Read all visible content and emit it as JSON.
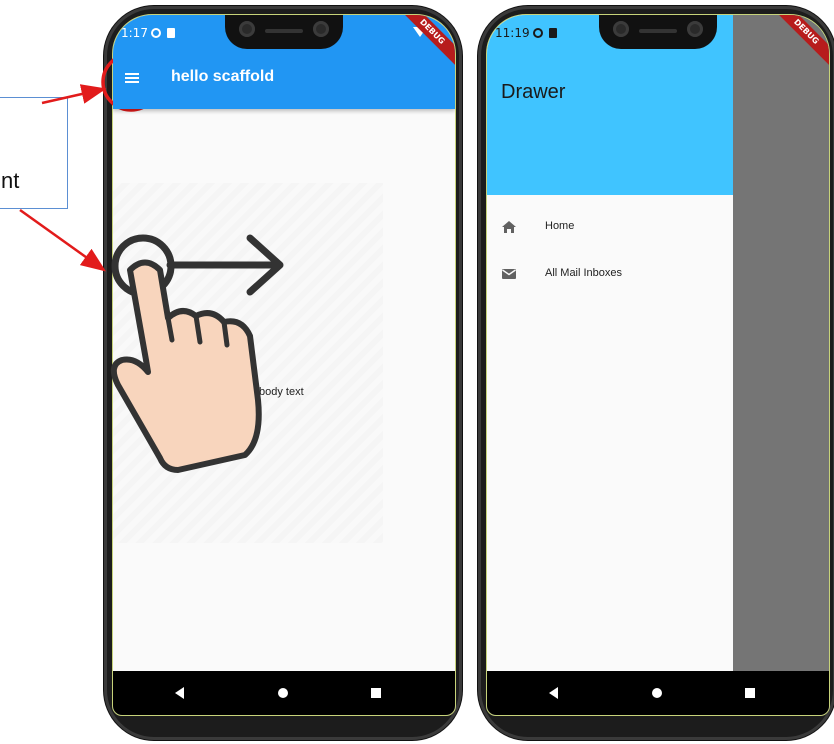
{
  "annotation": {
    "callout_text": "nt"
  },
  "left_phone": {
    "status_time": "1:17",
    "debug_label": "DEBUG",
    "appbar_title": "hello scaffold",
    "body_text": "body text"
  },
  "right_phone": {
    "status_time": "11:19",
    "debug_label": "DEBUG",
    "drawer_title": "Drawer",
    "drawer_items": [
      {
        "label": "Home",
        "icon": "home-icon"
      },
      {
        "label": "All Mail Inboxes",
        "icon": "mail-icon"
      }
    ]
  },
  "colors": {
    "appbar": "#2196f3",
    "drawer_header": "#40c4ff",
    "scrim": "#757575",
    "annotation_arrow": "#e21b1b",
    "debug_ribbon": "#b71c1c"
  }
}
